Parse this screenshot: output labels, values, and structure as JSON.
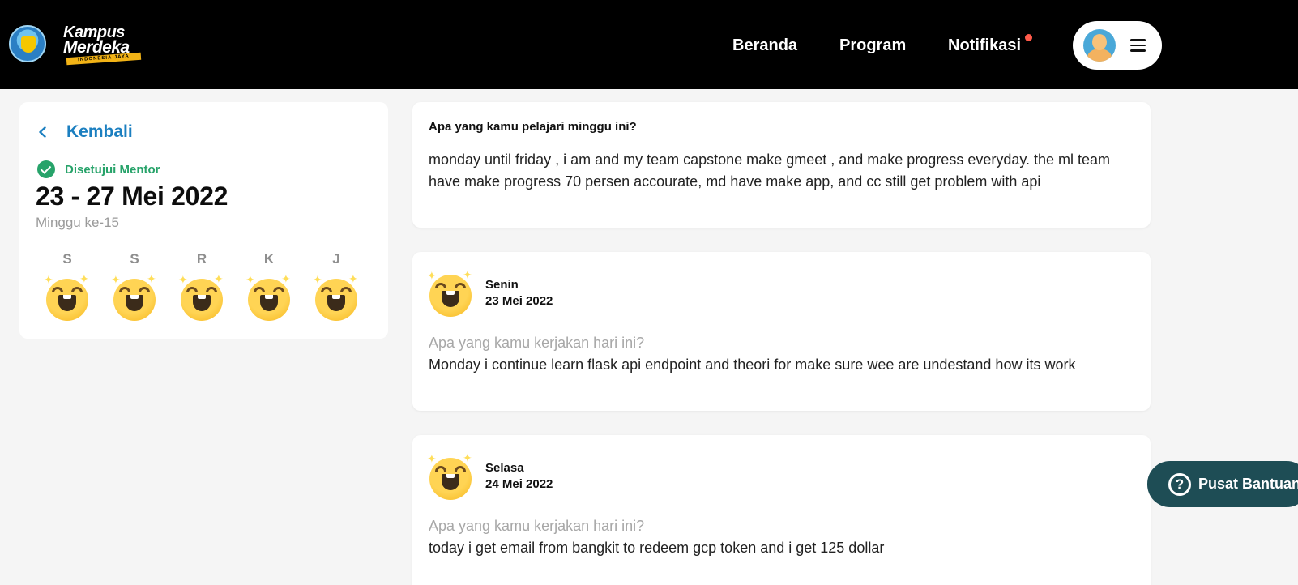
{
  "header": {
    "logo_line1": "Kampus",
    "logo_line2": "Merdeka",
    "logo_tagline": "INDONESIA JAYA",
    "nav": {
      "beranda": "Beranda",
      "program": "Program",
      "notifikasi": "Notifikasi"
    },
    "notification_dot_color": "#ff5a4a"
  },
  "sidebar": {
    "back_label": "Kembali",
    "status_label": "Disetujui Mentor",
    "week_range": "23 - 27 Mei 2022",
    "week_number": "Minggu ke-15",
    "days": [
      {
        "letter": "S",
        "mood_icon": "star-struck-emoji-icon"
      },
      {
        "letter": "S",
        "mood_icon": "star-struck-emoji-icon"
      },
      {
        "letter": "R",
        "mood_icon": "star-struck-emoji-icon"
      },
      {
        "letter": "K",
        "mood_icon": "star-struck-emoji-icon"
      },
      {
        "letter": "J",
        "mood_icon": "star-struck-emoji-icon"
      }
    ]
  },
  "weekly_summary": {
    "question": "Apa yang kamu pelajari minggu ini?",
    "answer": "monday until friday , i am and my team capstone make gmeet , and make progress everyday. the ml team have make progress 70 persen accourate, md have make app, and cc still get problem with api"
  },
  "entries": [
    {
      "day": "Senin",
      "date": "23 Mei 2022",
      "question": "Apa yang kamu kerjakan hari ini?",
      "answer": "Monday i continue learn flask api endpoint and theori for make sure wee are undestand how its work"
    },
    {
      "day": "Selasa",
      "date": "24 Mei 2022",
      "question": "Apa yang kamu kerjakan hari ini?",
      "answer": "today i get email from bangkit to redeem gcp token and i get 125 dollar"
    }
  ],
  "help": {
    "label": "Pusat Bantuan"
  },
  "colors": {
    "header_bg": "#000000",
    "accent_blue": "#1b7fc0",
    "approved_green": "#27a36a",
    "help_bg": "#1e4d55"
  }
}
